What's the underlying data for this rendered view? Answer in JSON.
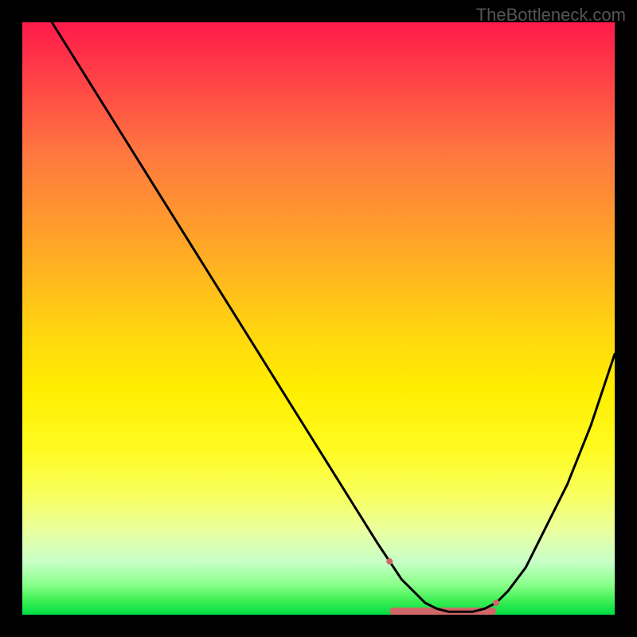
{
  "watermark": "TheBottleneck.com",
  "chart_data": {
    "type": "line",
    "title": "",
    "xlabel": "",
    "ylabel": "",
    "xlim": [
      0,
      100
    ],
    "ylim": [
      0,
      100
    ],
    "grid": false,
    "legend": false,
    "note": "Bottleneck curve over rainbow gradient background (red=high bottleneck at top, green=low at bottom). X is approximate component-performance percentile, Y is bottleneck percent (higher = worse).",
    "series": [
      {
        "name": "bottleneck-curve",
        "color": "#000000",
        "x": [
          5,
          10,
          15,
          20,
          25,
          30,
          35,
          40,
          45,
          50,
          55,
          60,
          62,
          64,
          66,
          68,
          70,
          72,
          74,
          76,
          78,
          80,
          82,
          85,
          88,
          92,
          96,
          100
        ],
        "y": [
          100,
          92,
          84,
          76,
          68,
          60,
          52,
          44,
          36,
          28,
          20,
          12,
          9,
          6,
          4,
          2,
          1,
          0.5,
          0.5,
          0.5,
          1,
          2,
          4,
          8,
          14,
          22,
          32,
          44
        ]
      }
    ],
    "markers": [
      {
        "name": "curve-marker-valley-left",
        "x": 62,
        "y": 9,
        "color": "#d06868",
        "size": 8
      },
      {
        "name": "curve-marker-valley-right",
        "x": 80,
        "y": 2,
        "color": "#d06868",
        "size": 8
      }
    ],
    "valley_band": {
      "x_start": 62,
      "x_end": 80,
      "y": 0.6,
      "color": "#d06868",
      "height": 1.2
    }
  }
}
